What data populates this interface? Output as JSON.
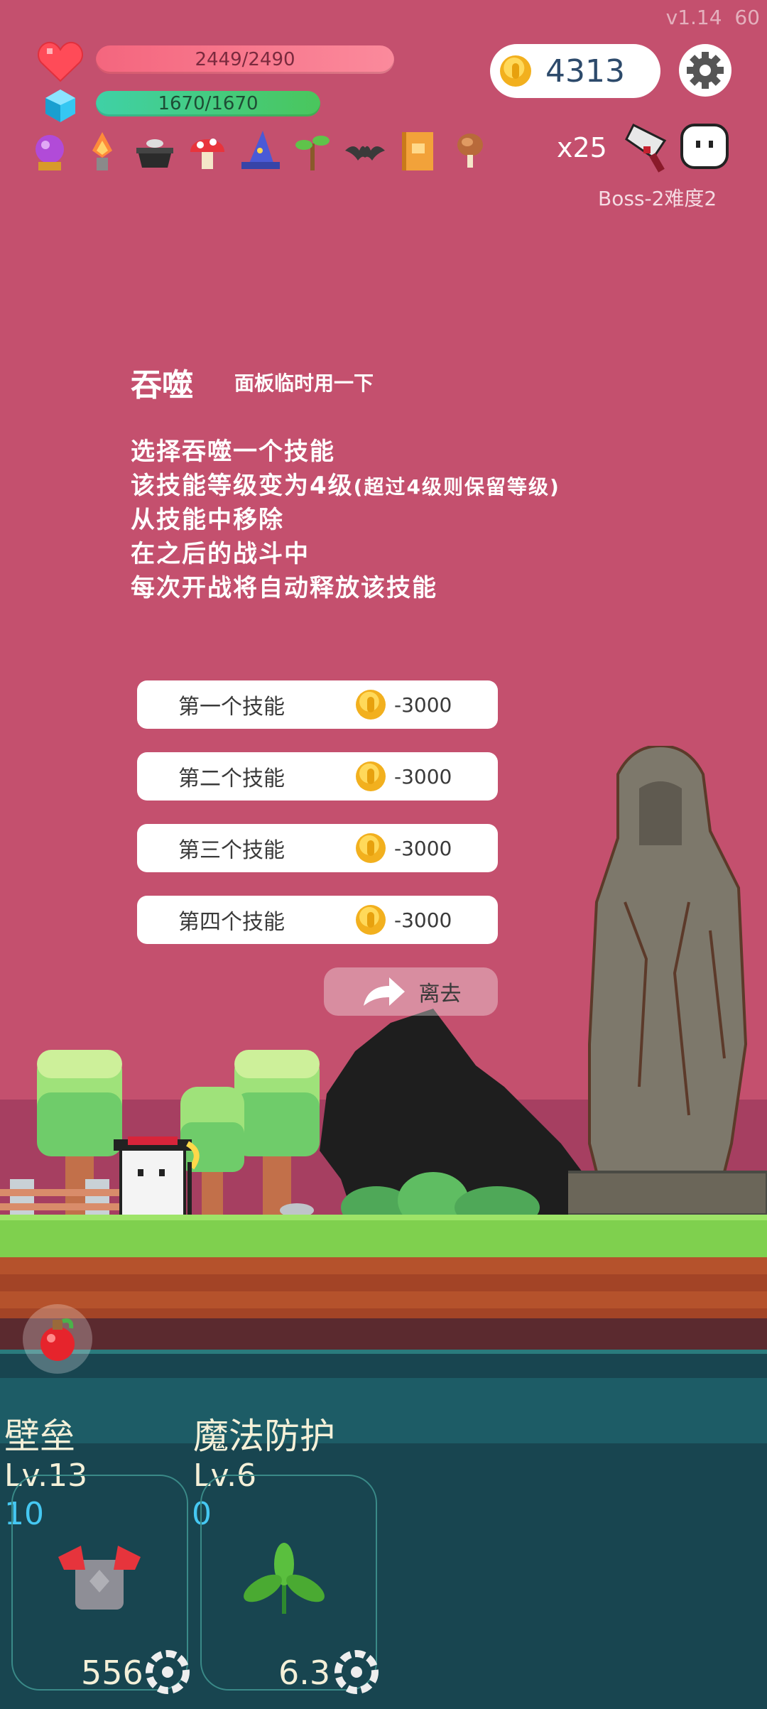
{
  "version": "v1.14",
  "fps": "60",
  "hud": {
    "hp": "2449/2490",
    "mp": "1670/1670",
    "coins": "4313",
    "multiplier": "x25",
    "stage": "Boss-2难度2",
    "items": [
      "crystal-ball-icon",
      "torch-icon",
      "cauldron-icon",
      "mushroom-icon",
      "wizard-hat-icon",
      "sapling-icon",
      "bat-icon",
      "book-icon",
      "meat-icon"
    ]
  },
  "event": {
    "title": "吞噬",
    "subtitle": "面板临时用一下",
    "lines": [
      "选择吞噬一个技能",
      "该技能等级变为4级",
      "(超过4级则保留等级)",
      "从技能中移除",
      "在之后的战斗中",
      "每次开战将自动释放该技能"
    ],
    "options": [
      {
        "label": "第一个技能",
        "cost": "-3000"
      },
      {
        "label": "第二个技能",
        "cost": "-3000"
      },
      {
        "label": "第三个技能",
        "cost": "-3000"
      },
      {
        "label": "第四个技能",
        "cost": "-3000"
      }
    ],
    "leave": "离去"
  },
  "skills": [
    {
      "name": "壁垒",
      "level": "Lv.13",
      "count": "10",
      "value": "556",
      "icon": "armor-icon"
    },
    {
      "name": "魔法防护",
      "level": "Lv.6",
      "count": "0",
      "value": "6.3",
      "icon": "leaf-icon"
    }
  ],
  "colors": {
    "background": "#c4506e",
    "hp": "#f4667e",
    "mp": "#3fd1a6",
    "panel": "#184550"
  }
}
